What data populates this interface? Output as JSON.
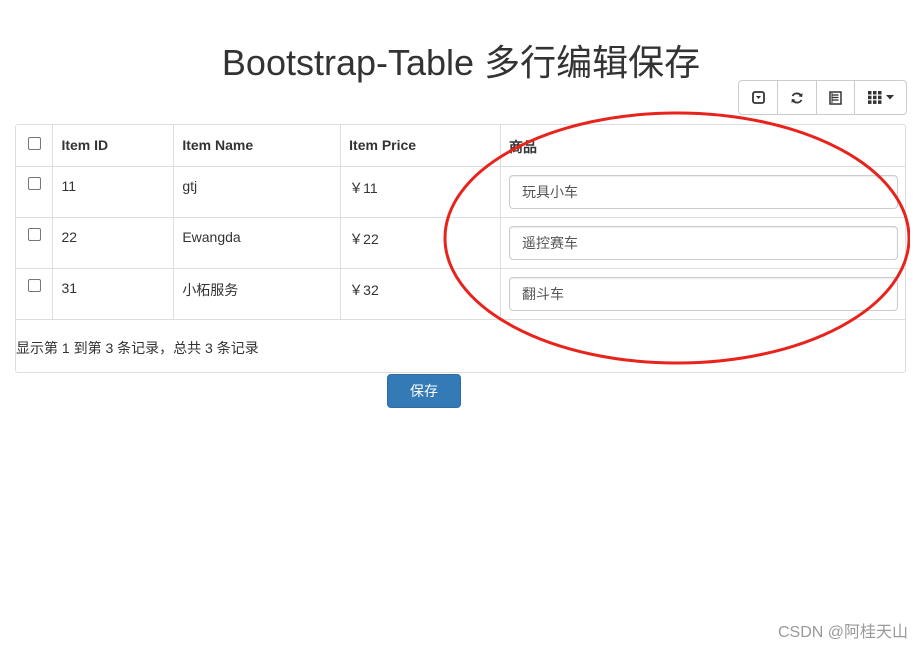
{
  "page": {
    "title": "Bootstrap-Table 多行编辑保存",
    "save_label": "保存",
    "watermark": "CSDN @阿桂天山"
  },
  "toolbar": {
    "buttons": [
      {
        "icon": "toggle-collapse-icon"
      },
      {
        "icon": "refresh-icon"
      },
      {
        "icon": "toggle-view-icon"
      },
      {
        "icon": "columns-grid-icon",
        "has_dropdown": true
      }
    ]
  },
  "table": {
    "headers": [
      "Item ID",
      "Item Name",
      "Item Price",
      "商品"
    ],
    "rows": [
      {
        "id": "11",
        "name": "gtj",
        "price": "￥11",
        "goods": "玩具小车"
      },
      {
        "id": "22",
        "name": "Ewangda",
        "price": "￥22",
        "goods": "遥控赛车"
      },
      {
        "id": "31",
        "name": "小柘服务",
        "price": "￥32",
        "goods": "翻斗车"
      }
    ],
    "pagination_info": "显示第 1 到第 3 条记录，总共 3 条记录"
  },
  "colors": {
    "primary": "#337ab7",
    "annotation": "#e8231b",
    "border": "#dddddd"
  }
}
